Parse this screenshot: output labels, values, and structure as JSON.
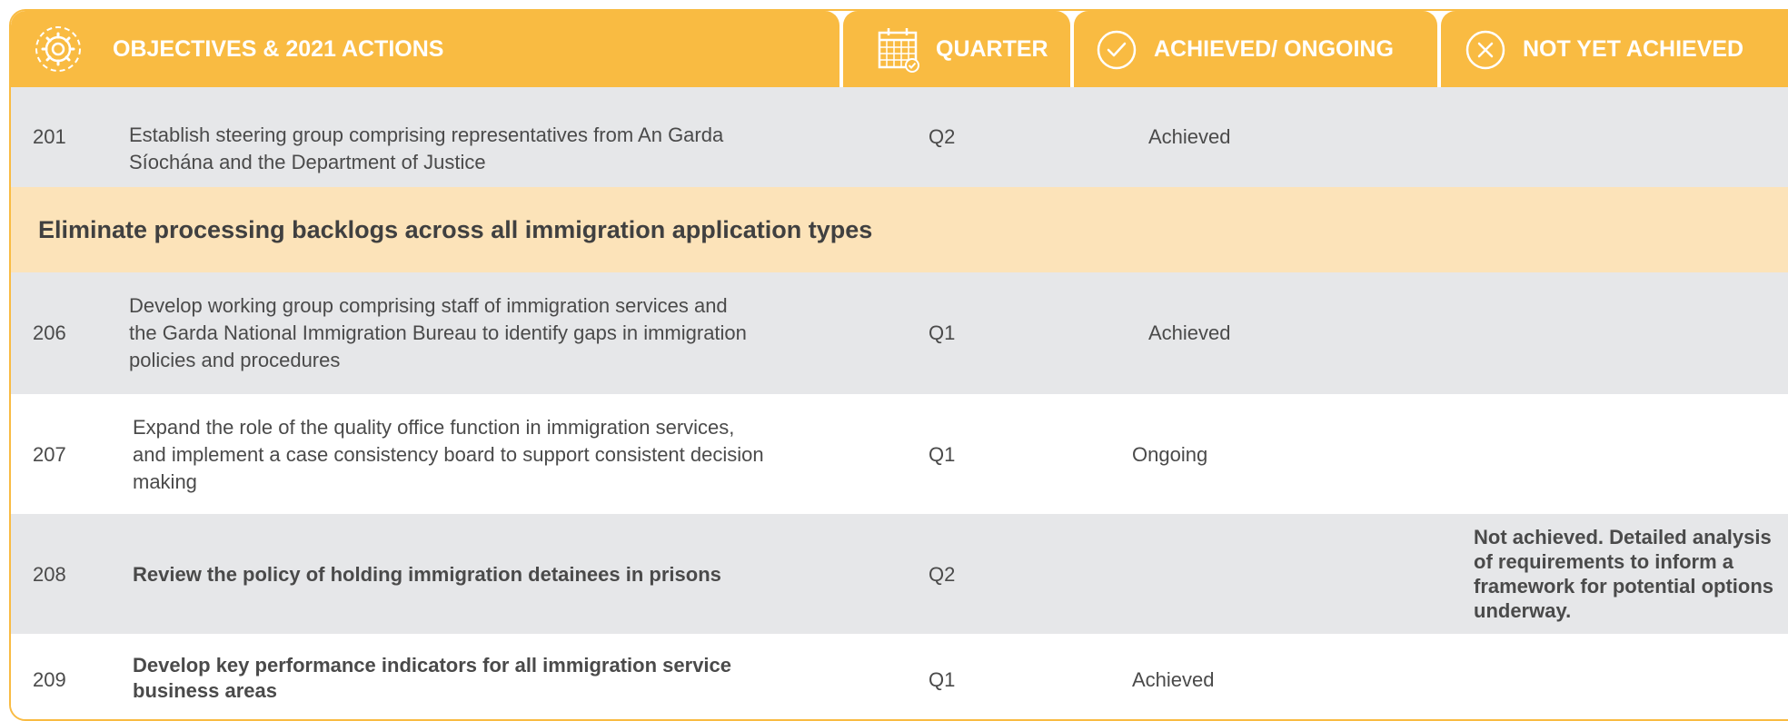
{
  "header": {
    "objectives_label": "OBJECTIVES & 2021 ACTIONS",
    "quarter_label": "QUARTER",
    "achieved_label": "ACHIEVED/ ONGOING",
    "not_achieved_label": "NOT YET ACHIEVED",
    "icons": [
      "gear-icon",
      "calendar-icon",
      "check-circle-icon",
      "x-circle-icon"
    ],
    "color": "#f9bb42"
  },
  "rows": [
    {
      "num": "201",
      "action_lines": [
        "Establish steering group comprising representatives from An Garda",
        "Síochána and the Department of Justice"
      ],
      "quarter": "Q2",
      "status": "Achieved",
      "note": ""
    },
    {
      "num": "206",
      "action_lines": [
        "Develop working group comprising staff of immigration services and",
        "the Garda National Immigration Bureau to identify gaps in immigration",
        "policies and procedures"
      ],
      "quarter": "Q1",
      "status": "Achieved",
      "note": ""
    },
    {
      "num": "207",
      "action_lines": [
        "Expand the role of the quality office function in immigration services,",
        "and implement a case consistency board to support consistent decision",
        "making"
      ],
      "quarter": "Q1",
      "status": "Ongoing",
      "note": ""
    },
    {
      "num": "208",
      "action_lines": [
        "Review the policy of holding immigration detainees in prisons"
      ],
      "quarter": "Q2",
      "status": "",
      "note_lines": [
        "Not achieved. Detailed analysis",
        "of requirements to inform a",
        "framework for potential options",
        "underway."
      ]
    },
    {
      "num": "209",
      "action_lines": [
        "Develop key performance indicators for all immigration service",
        "business areas"
      ],
      "quarter": "Q1",
      "status": "Achieved",
      "note": ""
    }
  ],
  "section": {
    "title": "Eliminate processing backlogs across all immigration application types",
    "color": "#fce3b9"
  },
  "colors": {
    "row_grey": "#e6e7e9",
    "text": "#4a4a4a"
  }
}
